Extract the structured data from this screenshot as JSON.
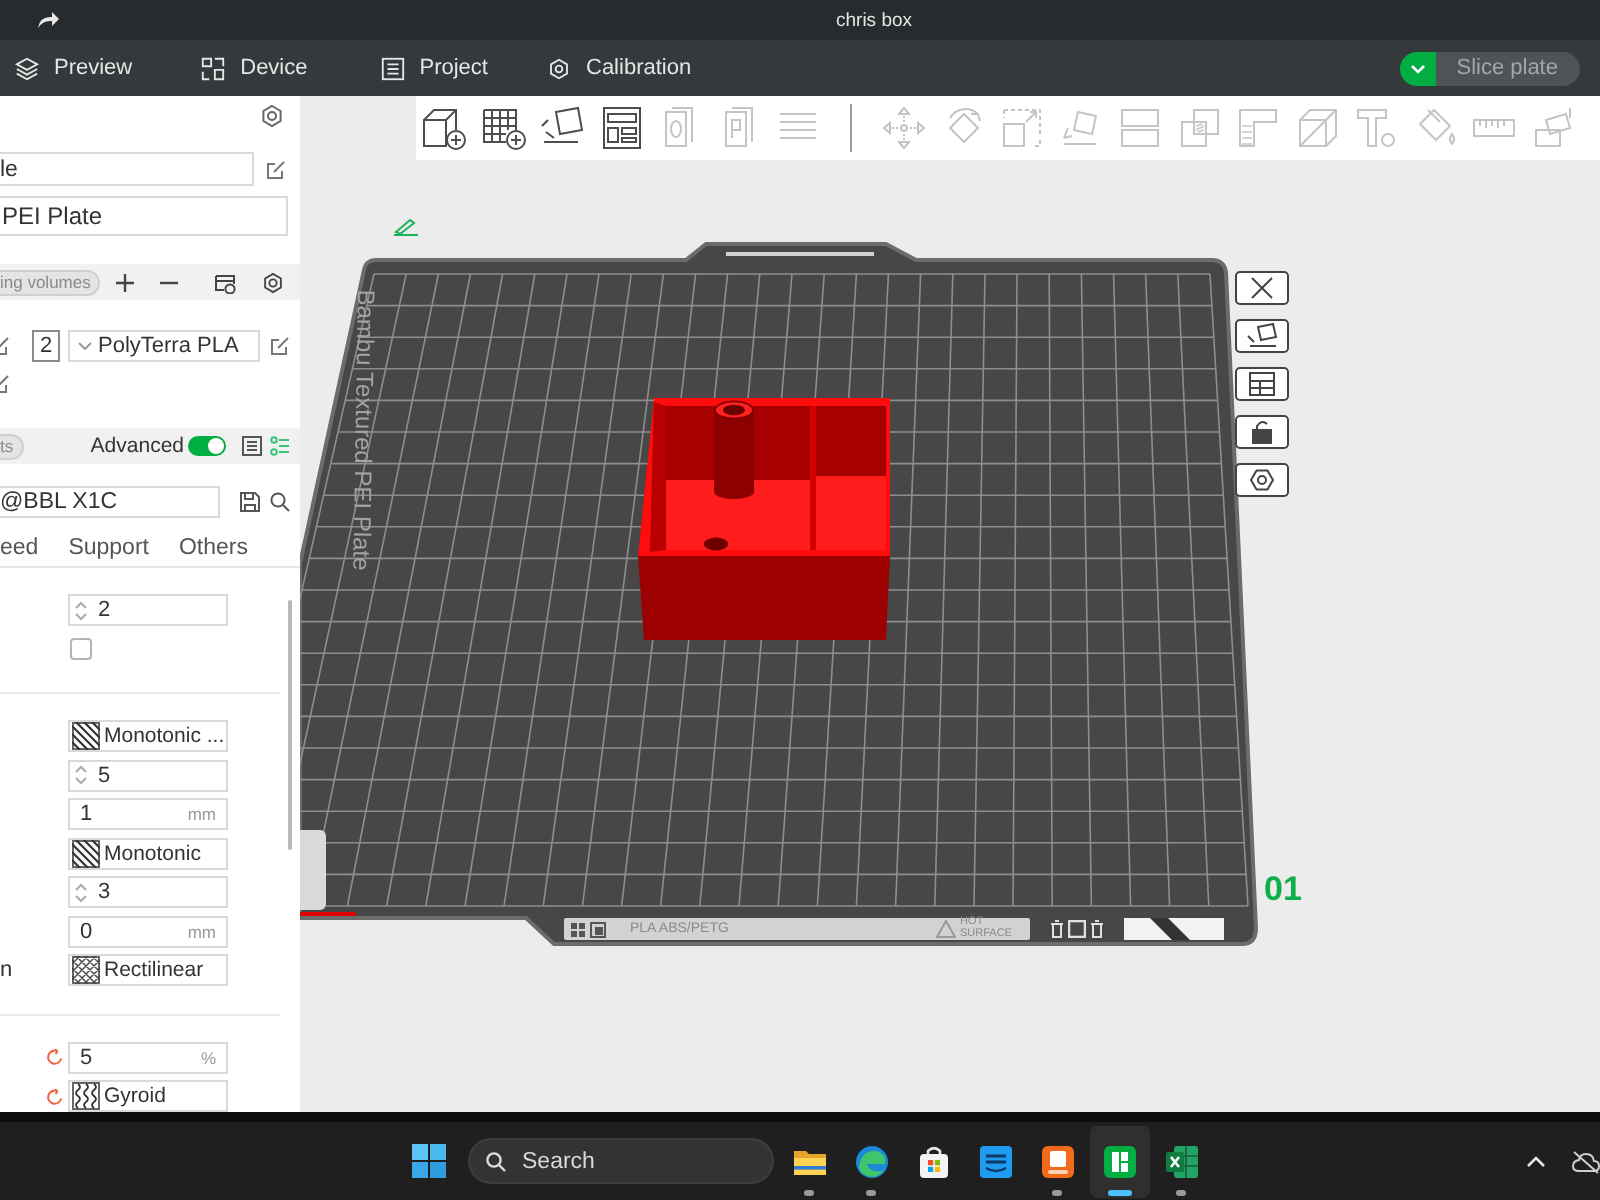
{
  "window": {
    "title": "chris box"
  },
  "menu": [
    {
      "kind": "preview",
      "label": "Preview"
    },
    {
      "kind": "device",
      "label": "Device"
    },
    {
      "kind": "project",
      "label": "Project"
    },
    {
      "kind": "calibration",
      "label": "Calibration"
    }
  ],
  "slice_button": {
    "label": "Slice plate",
    "disabled": true
  },
  "toolbar": [
    {
      "tools": [
        {
          "kind": "addpart",
          "disabled": false
        },
        {
          "kind": "addplate",
          "disabled": false
        },
        {
          "kind": "orient",
          "disabled": false
        },
        {
          "kind": "arrange",
          "disabled": false
        },
        {
          "kind": "pagezero",
          "disabled": true
        },
        {
          "kind": "pagep",
          "disabled": true
        },
        {
          "kind": "lines",
          "disabled": true
        }
      ]
    },
    {
      "tools": [
        {
          "kind": "move",
          "disabled": true
        },
        {
          "kind": "rotate",
          "disabled": true
        },
        {
          "kind": "scale",
          "disabled": true
        },
        {
          "kind": "layface",
          "disabled": true
        },
        {
          "kind": "split",
          "disabled": true
        },
        {
          "kind": "boolean",
          "disabled": true
        },
        {
          "kind": "support",
          "disabled": true
        },
        {
          "kind": "cube",
          "disabled": true
        },
        {
          "kind": "text",
          "disabled": true
        },
        {
          "kind": "paint",
          "disabled": true
        },
        {
          "kind": "measure",
          "disabled": true
        },
        {
          "kind": "assemble",
          "disabled": true
        }
      ]
    }
  ],
  "sidebar": {
    "printer": {
      "value": "le"
    },
    "plate_type": {
      "value": "PEI Plate"
    },
    "filament_header": {
      "pill": "ing volumes"
    },
    "filaments": [
      {
        "number": "2",
        "name": "PolyTerra PLA"
      }
    ],
    "process_header": {
      "pill": "ts",
      "advanced": {
        "label": "Advanced",
        "on": true
      }
    },
    "preset": {
      "value": "@BBL X1C"
    },
    "tabs": [
      {
        "label": "eed"
      },
      {
        "label": "Support"
      },
      {
        "label": "Others"
      }
    ],
    "groups": [
      {
        "rows": [
          {
            "kind": "spin",
            "value": "2",
            "modified": false
          },
          {
            "kind": "checkbox",
            "checked": false,
            "modified": false
          }
        ]
      },
      {
        "rows": [
          {
            "kind": "lines",
            "value": "Monotonic ...",
            "modified": false
          },
          {
            "kind": "spin",
            "value": "5",
            "modified": false
          },
          {
            "kind": "unit",
            "value": "1",
            "unit": "mm",
            "modified": false
          },
          {
            "kind": "lines",
            "value": "Monotonic",
            "modified": false
          },
          {
            "kind": "spin",
            "value": "3",
            "modified": false
          },
          {
            "kind": "unit",
            "value": "0",
            "unit": "mm",
            "modified": false
          },
          {
            "kind": "hatch",
            "label": "n",
            "value": "Rectilinear",
            "modified": false
          }
        ]
      },
      {
        "rows": [
          {
            "kind": "unit",
            "value": "5",
            "unit": "%",
            "modified": true
          },
          {
            "kind": "wave",
            "value": "Gyroid",
            "modified": true
          }
        ]
      }
    ]
  },
  "plate": {
    "name": "Bambu Textured PEI Plate",
    "number": "01",
    "labels": [
      {
        "kind": "material",
        "text": "PLA ABS/PETG"
      },
      {
        "kind": "warning",
        "text": "HOT SURFACE"
      }
    ]
  },
  "taskbar": {
    "search": {
      "placeholder": "Search"
    },
    "apps": [
      {
        "kind": "files",
        "running": true,
        "active": false
      },
      {
        "kind": "browser",
        "running": true,
        "active": false
      },
      {
        "kind": "store",
        "running": false,
        "active": false
      },
      {
        "kind": "video",
        "running": false,
        "active": false
      },
      {
        "kind": "editor",
        "running": true,
        "active": false
      },
      {
        "kind": "slicer",
        "running": true,
        "active": true
      },
      {
        "kind": "sheet",
        "running": true,
        "active": false
      }
    ]
  }
}
